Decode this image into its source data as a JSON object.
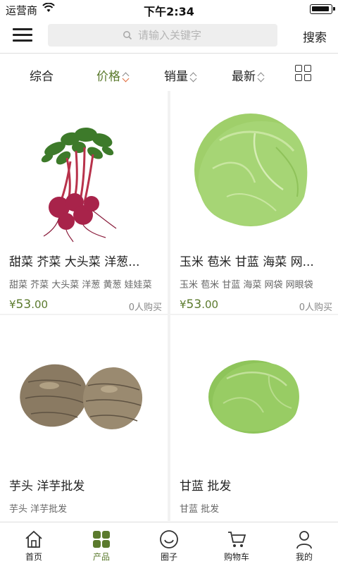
{
  "status_bar": {
    "carrier": "运营商",
    "time": "下午2:34"
  },
  "header": {
    "search_placeholder": "请输入关键字",
    "search_label": "搜索"
  },
  "sort_bar": {
    "items": [
      {
        "label": "综合",
        "has_arrows": false,
        "active": false
      },
      {
        "label": "价格",
        "has_arrows": true,
        "active": true
      },
      {
        "label": "销量",
        "has_arrows": true,
        "active": false
      },
      {
        "label": "最新",
        "has_arrows": true,
        "active": false
      }
    ]
  },
  "products": [
    {
      "name": "甜菜 芥菜 大头菜 洋葱...",
      "tags": "甜菜 芥菜 大头菜 洋葱 黄葱 娃娃菜",
      "currency": "¥",
      "price_int": "53",
      "price_dec": ".00",
      "sold": "0人购买",
      "image": "beetroot"
    },
    {
      "name": "玉米 苞米 甘蓝 海菜 网...",
      "tags": "玉米 苞米 甘蓝 海菜 网袋 网眼袋",
      "currency": "¥",
      "price_int": "53",
      "price_dec": ".00",
      "sold": "0人购买",
      "image": "cabbage"
    },
    {
      "name": "芋头 洋芋批发",
      "tags": "芋头 洋芋批发",
      "currency": "",
      "price_int": "",
      "price_dec": "",
      "sold": "",
      "image": "taro"
    },
    {
      "name": "甘蓝  批发",
      "tags": "甘蓝  批发",
      "currency": "",
      "price_int": "",
      "price_dec": "",
      "sold": "",
      "image": "cabbage-small"
    }
  ],
  "tab_bar": {
    "items": [
      {
        "label": "首页",
        "icon": "home-icon",
        "active": false
      },
      {
        "label": "产品",
        "icon": "products-grid-icon",
        "active": true
      },
      {
        "label": "圈子",
        "icon": "circle-smile-icon",
        "active": false
      },
      {
        "label": "购物车",
        "icon": "cart-icon",
        "active": false
      },
      {
        "label": "我的",
        "icon": "user-icon",
        "active": false
      }
    ]
  },
  "colors": {
    "accent": "#5b7a2d",
    "sort_active_arrow": "#e06a3a",
    "background": "#ffffff",
    "grid_gap": "#f2f2f2"
  }
}
